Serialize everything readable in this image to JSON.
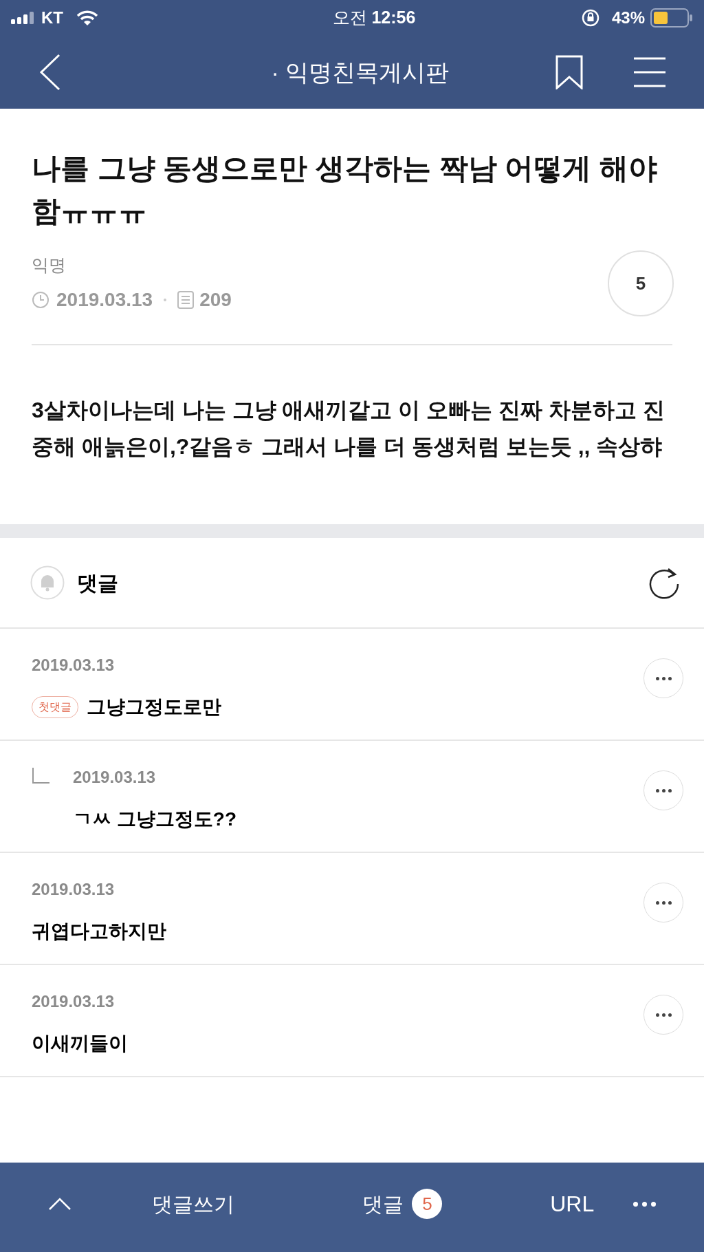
{
  "status_bar": {
    "carrier": "KT",
    "time_prefix": "오전",
    "time": "12:56",
    "battery": "43%"
  },
  "header": {
    "title": "· 익명친목게시판"
  },
  "post": {
    "title": "나를 그냥 동생으로만 생각하는 짝남 어떻게 해야함ㅠㅠㅠ",
    "author": "익명",
    "date": "2019.03.13",
    "views": "209",
    "comment_count": "5",
    "body": "3살차이나는데 나는 그냥 애새끼같고 이 오빠는 진짜 차분하고 진중해 애늙은이,?같음ㅎ 그래서 나를 더 동생처럼 보는듯 ,, 속상햐"
  },
  "comments_section": {
    "title": "댓글"
  },
  "comments": [
    {
      "kind": "comment",
      "date": "2019.03.13",
      "badge": "첫댓글",
      "text": "그냥그정도로만"
    },
    {
      "kind": "reply",
      "date": "2019.03.13",
      "text": "ㄱㅆ 그냥그정도??"
    },
    {
      "kind": "comment",
      "date": "2019.03.13",
      "text": "귀엽다고하지만"
    },
    {
      "kind": "comment",
      "date": "2019.03.13",
      "text": "이새끼들이"
    }
  ],
  "bottom_bar": {
    "write": "댓글쓰기",
    "comments": "댓글",
    "count": "5",
    "url": "URL"
  }
}
